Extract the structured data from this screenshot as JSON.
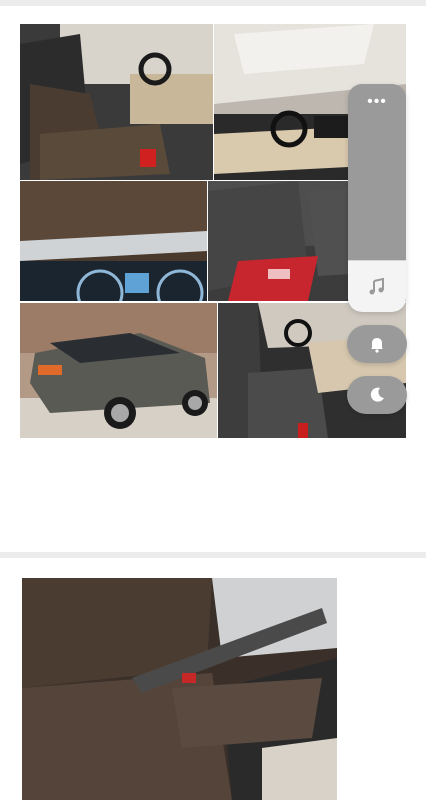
{
  "floating_panel": {
    "menu_label": "•••",
    "music_icon": "music-note-icon"
  },
  "floating_buttons": {
    "notification_icon": "bell-icon",
    "dark_mode_icon": "moon-icon"
  },
  "images": [
    "car-interior-front-seats",
    "car-headliner-and-dashboard",
    "car-seat-cover-closeup",
    "car-instrument-cluster",
    "car-rear-seats-with-red-logo-mat",
    "car-exterior-rear-view",
    "car-interior-dashboard-side",
    "car-seat-cover-large"
  ]
}
